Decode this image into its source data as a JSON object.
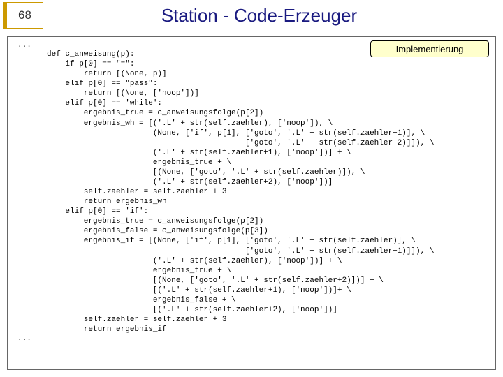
{
  "page_number": "68",
  "title": "Station - Code-Erzeuger",
  "badge": "Implementierung",
  "dots_top": "...",
  "dots_bottom": "...",
  "code": "def c_anweisung(p):\n    if p[0] == \"=\":\n        return [(None, p)]\n    elif p[0] == \"pass\":\n        return [(None, ['noop'])]\n    elif p[0] == 'while':\n        ergebnis_true = c_anweisungsfolge(p[2])\n        ergebnis_wh = [('.L' + str(self.zaehler), ['noop']), \\\n                       (None, ['if', p[1], ['goto', '.L' + str(self.zaehler+1)], \\\n                                           ['goto', '.L' + str(self.zaehler+2)]]), \\\n                       ('.L' + str(self.zaehler+1), ['noop'])] + \\\n                       ergebnis_true + \\\n                       [(None, ['goto', '.L' + str(self.zaehler)]), \\\n                       ('.L' + str(self.zaehler+2), ['noop'])]\n        self.zaehler = self.zaehler + 3\n        return ergebnis_wh\n    elif p[0] == 'if':\n        ergebnis_true = c_anweisungsfolge(p[2])\n        ergebnis_false = c_anweisungsfolge(p[3])\n        ergebnis_if = [(None, ['if', p[1], ['goto', '.L' + str(self.zaehler)], \\\n                                           ['goto', '.L' + str(self.zaehler+1)]]), \\\n                       ('.L' + str(self.zaehler), ['noop'])] + \\\n                       ergebnis_true + \\\n                       [(None, ['goto', '.L' + str(self.zaehler+2)])] + \\\n                       [('.L' + str(self.zaehler+1), ['noop'])]+ \\\n                       ergebnis_false + \\\n                       [('.L' + str(self.zaehler+2), ['noop'])]\n        self.zaehler = self.zaehler + 3\n        return ergebnis_if"
}
